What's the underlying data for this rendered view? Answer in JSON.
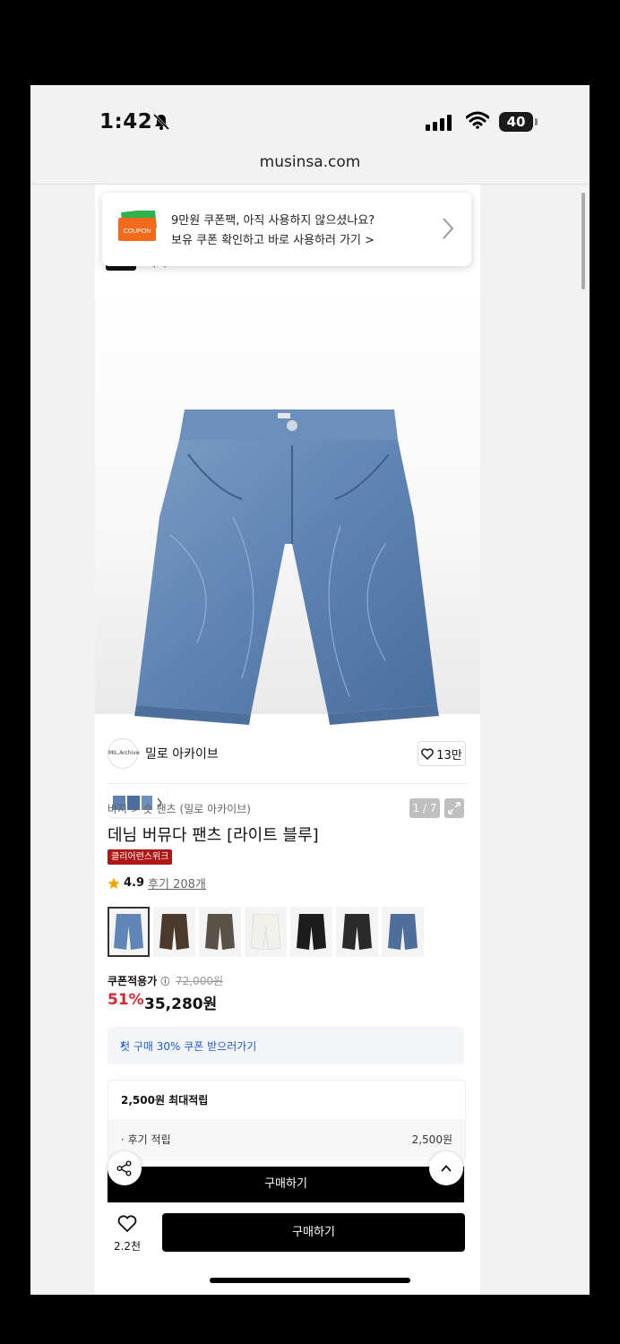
{
  "status_bar": {
    "time": "1:42",
    "battery": "40"
  },
  "browser": {
    "url": "musinsa.com"
  },
  "coupon_banner": {
    "icon_text": "COUPON",
    "line1": "9만원 쿠폰팩, 아직 사용하지 않으셨나요?",
    "line2": "보유 쿠폰 확인하고 바로 사용하러 가기 >"
  },
  "top_strip": {
    "category": "바지"
  },
  "gallery": {
    "counter": "1 / 7"
  },
  "brand": {
    "logo_text": "MIL.Archive",
    "name": "밀로 아카이브",
    "likes": "13만"
  },
  "product": {
    "breadcrumb": "바지 > 숏 팬츠 (밀로 아카이브)",
    "title": "데님 버뮤다 팬츠 [라이트 블루]",
    "badge": "클리어런스위크",
    "rating": "4.9",
    "reviews": "후기 208개",
    "swatch_colors": [
      "#5f86b6",
      "#4b3a2c",
      "#5a5247",
      "#f2f0ea",
      "#1c1c1c",
      "#2a2a2a",
      "#4e6f9c"
    ]
  },
  "price": {
    "label": "쿠폰적용가",
    "original": "72,000원",
    "discount": "51%",
    "final": "35,280원"
  },
  "first_purchase": {
    "label": "첫 구매 30% 쿠폰 받으러가기",
    "chevron": "›"
  },
  "points": {
    "max_label": "2,500원 최대적립",
    "review_label": "· 후기 적립",
    "review_value": "2,500원"
  },
  "actions": {
    "buy_upper": "구매하기",
    "buy_main": "구매하기",
    "wish_count": "2.2천"
  }
}
